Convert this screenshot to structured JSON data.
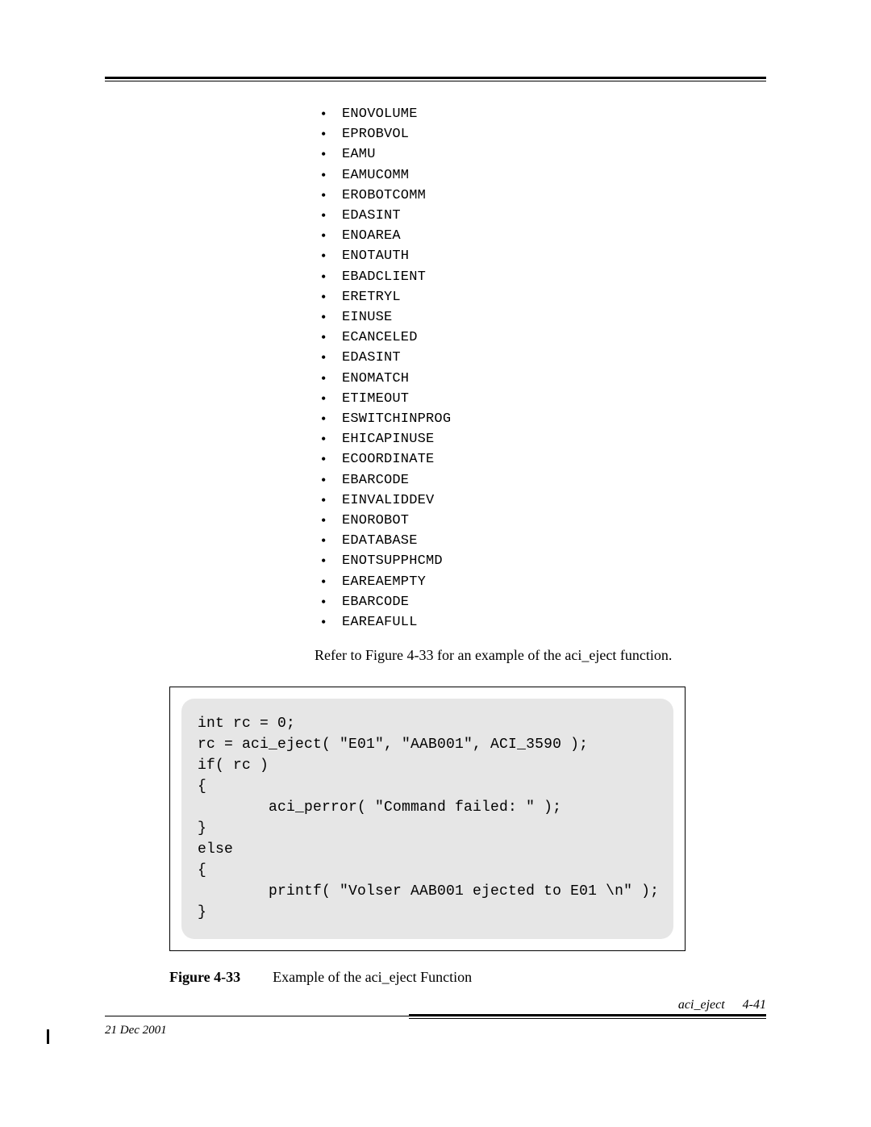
{
  "errors": [
    "ENOVOLUME",
    "EPROBVOL",
    "EAMU",
    "EAMUCOMM",
    "EROBOTCOMM",
    "EDASINT",
    "ENOAREA",
    "ENOTAUTH",
    "EBADCLIENT",
    "ERETRYL",
    "EINUSE",
    "ECANCELED",
    "EDASINT",
    "ENOMATCH",
    "ETIMEOUT",
    "ESWITCHINPROG",
    "EHICAPINUSE",
    "ECOORDINATE",
    "EBARCODE",
    "EINVALIDDEV",
    "ENOROBOT",
    "EDATABASE",
    "ENOTSUPPHCMD",
    "EAREAEMPTY",
    "EBARCODE",
    "EAREAFULL"
  ],
  "refer_text": "Refer to Figure 4-33 for an example of the aci_eject function.",
  "code": "int rc = 0;\nrc = aci_eject( \"E01\", \"AAB001\", ACI_3590 );\nif( rc )\n{\n        aci_perror( \"Command failed: \" );\n}\nelse\n{\n        printf( \"Volser AAB001 ejected to E01 \\n\" );\n}",
  "figure": {
    "label": "Figure 4-33",
    "caption": "Example of the aci_eject Function"
  },
  "footer": {
    "date": "21 Dec 2001",
    "section": "aci_eject",
    "page": "4-41"
  }
}
